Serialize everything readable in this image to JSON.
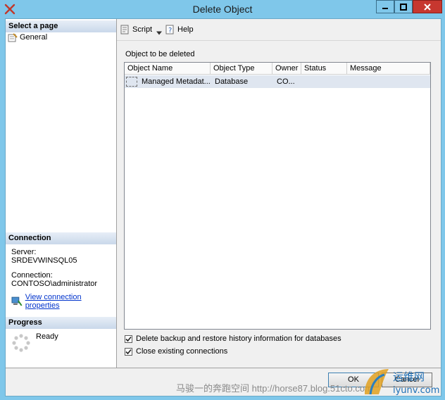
{
  "window": {
    "title": "Delete Object"
  },
  "left_pane": {
    "select_page_header": "Select a page",
    "pages": [
      {
        "label": "General"
      }
    ],
    "connection_header": "Connection",
    "server_label": "Server:",
    "server_value": "SRDEVWINSQL05",
    "connection_label": "Connection:",
    "connection_value": "CONTOSO\\administrator",
    "view_connection_link": "View connection properties",
    "progress_header": "Progress",
    "progress_status": "Ready"
  },
  "toolbar": {
    "script_label": "Script",
    "help_label": "Help"
  },
  "main": {
    "objects_label": "Object to be deleted",
    "columns": [
      "Object Name",
      "Object Type",
      "Owner",
      "Status",
      "Message"
    ],
    "rows": [
      {
        "name": "Managed Metadat...",
        "type": "Database",
        "owner": "CO...",
        "status": "",
        "message": ""
      }
    ],
    "options": [
      {
        "label": "Delete backup and restore history information for databases",
        "checked": true
      },
      {
        "label": "Close existing connections",
        "checked": true
      }
    ]
  },
  "buttons": {
    "ok": "OK",
    "cancel": "Cancel"
  },
  "watermark": {
    "text": "马骏一的奔跑空间 http://horse87.blog.51cto.com",
    "logo_text": "运维网",
    "logo_sub": "iyunv.com"
  },
  "colors": {
    "titlebar": "#7fc7ea",
    "close_button": "#c7372f",
    "link": "#0033cc"
  }
}
